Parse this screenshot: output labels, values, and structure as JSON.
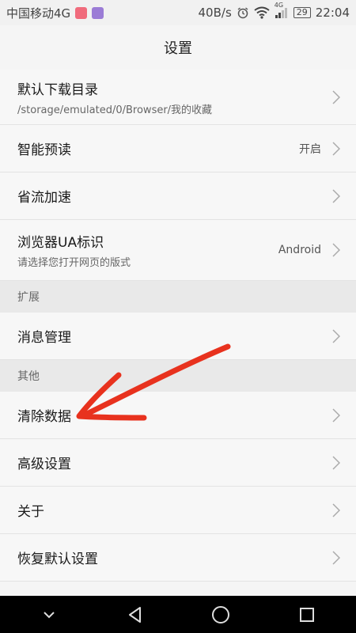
{
  "status_bar": {
    "carrier": "中国移动4G",
    "net_speed": "40B/s",
    "signal_label": "4G",
    "battery": "29",
    "time": "22:04",
    "icons": [
      "app-notification-icon",
      "gallery-notification-icon",
      "alarm-icon",
      "wifi-icon",
      "cell-signal-icon",
      "battery-icon"
    ]
  },
  "header": {
    "title": "设置"
  },
  "settings": {
    "download_dir": {
      "title": "默认下载目录",
      "subtitle": "/storage/emulated/0/Browser/我的收藏"
    },
    "smart_preload": {
      "title": "智能预读",
      "value": "开启"
    },
    "data_saver": {
      "title": "省流加速"
    },
    "ua": {
      "title": "浏览器UA标识",
      "subtitle": "请选择您打开网页的版式",
      "value": "Android"
    }
  },
  "sections": {
    "extensions": "扩展",
    "other": "其他"
  },
  "extensions": {
    "message_management": "消息管理"
  },
  "other": {
    "clear_data": "清除数据",
    "advanced": "高级设置",
    "about": "关于",
    "restore_defaults": "恢复默认设置"
  },
  "nav_bar": {
    "icons": [
      "collapse-icon",
      "back-icon",
      "home-icon",
      "recents-icon"
    ]
  },
  "colors": {
    "annotation": "#e8321e",
    "nav_background": "#000000",
    "list_background": "#f7f7f7",
    "section_background": "#e9e9e9"
  }
}
